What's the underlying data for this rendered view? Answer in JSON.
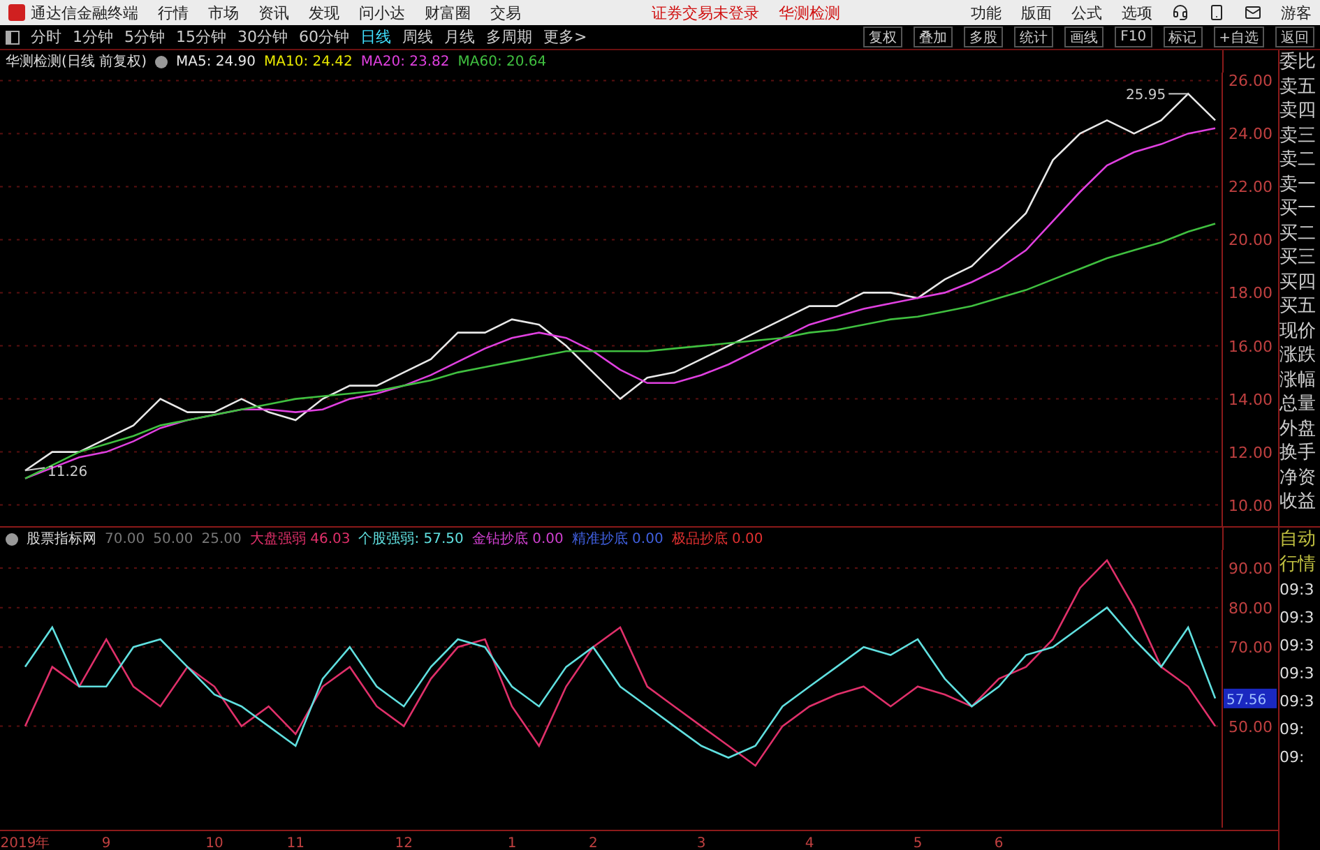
{
  "menu_bar": {
    "app_title": "通达信金融终端",
    "menus": [
      "行情",
      "市场",
      "资讯",
      "发现",
      "问小达",
      "财富圈",
      "交易"
    ],
    "notices": [
      "证券交易未登录",
      "华测检测"
    ],
    "tools": [
      "功能",
      "版面",
      "公式",
      "选项"
    ],
    "user": "游客"
  },
  "toolbar": {
    "periods": [
      {
        "label": "分时",
        "selected": false
      },
      {
        "label": "1分钟",
        "selected": false
      },
      {
        "label": "5分钟",
        "selected": false
      },
      {
        "label": "15分钟",
        "selected": false
      },
      {
        "label": "30分钟",
        "selected": false
      },
      {
        "label": "60分钟",
        "selected": false
      },
      {
        "label": "日线",
        "selected": true
      },
      {
        "label": "周线",
        "selected": false
      },
      {
        "label": "月线",
        "selected": false
      },
      {
        "label": "多周期",
        "selected": false
      },
      {
        "label": "更多>",
        "selected": false
      }
    ],
    "actions": [
      "复权",
      "叠加",
      "多股",
      "统计",
      "画线",
      "F10",
      "标记",
      "+自选",
      "返回"
    ]
  },
  "main_chart": {
    "title": "华测检测(日线 前复权)",
    "legend": [
      {
        "label": "MA5: 24.90",
        "color": "#e8e8e8"
      },
      {
        "label": "MA10: 24.42",
        "color": "#e8e800"
      },
      {
        "label": "MA20: 23.82",
        "color": "#e040e0"
      },
      {
        "label": "MA60: 20.64",
        "color": "#40c040"
      }
    ],
    "high_mark": "25.95",
    "low_mark": "11.26",
    "chart_data": {
      "type": "line",
      "grid": true,
      "categories": [
        null,
        null,
        null,
        null,
        null,
        null,
        null,
        null,
        null,
        null,
        null,
        null,
        null,
        null,
        null,
        null,
        null,
        null,
        null,
        null,
        null,
        null,
        null,
        null,
        null,
        null,
        null,
        null,
        null,
        null,
        null,
        null,
        null,
        null,
        null,
        null,
        null,
        null,
        null,
        null,
        null,
        null,
        null,
        null,
        null
      ],
      "ylim": [
        9.2,
        26.3
      ],
      "yticks": [
        {
          "value": 10,
          "label": "10.00"
        },
        {
          "value": 12,
          "label": "12.00"
        },
        {
          "value": 14,
          "label": "14.00"
        },
        {
          "value": 16,
          "label": "16.00"
        },
        {
          "value": 18,
          "label": "18.00"
        },
        {
          "value": 20,
          "label": "20.00"
        },
        {
          "value": 22,
          "label": "22.00"
        },
        {
          "value": 24,
          "label": "24.00"
        },
        {
          "value": 26,
          "label": "26.00"
        }
      ],
      "series": [
        {
          "color": "#e8e8e8",
          "values": [
            11.3,
            12,
            12,
            12.5,
            13,
            14,
            13.5,
            13.5,
            14,
            13.5,
            13.2,
            14,
            14.5,
            14.5,
            15,
            15.5,
            16.5,
            16.5,
            17,
            16.8,
            16,
            15,
            14,
            14.8,
            15,
            15.5,
            16,
            16.5,
            17,
            17.5,
            17.5,
            18,
            18,
            17.8,
            18.5,
            19,
            20,
            21,
            23,
            24,
            24.5,
            24,
            24.5,
            25.5,
            24.5
          ]
        },
        {
          "color": "#e040e0",
          "values": [
            11,
            11.4,
            11.8,
            12,
            12.4,
            12.9,
            13.2,
            13.4,
            13.6,
            13.6,
            13.5,
            13.6,
            14,
            14.2,
            14.5,
            14.9,
            15.4,
            15.9,
            16.3,
            16.5,
            16.3,
            15.8,
            15.1,
            14.6,
            14.6,
            14.9,
            15.3,
            15.8,
            16.3,
            16.8,
            17.1,
            17.4,
            17.6,
            17.8,
            18,
            18.4,
            18.9,
            19.6,
            20.7,
            21.8,
            22.8,
            23.3,
            23.6,
            24,
            24.2
          ]
        },
        {
          "color": "#40c040",
          "values": [
            11,
            11.5,
            12,
            12.3,
            12.6,
            13,
            13.2,
            13.4,
            13.6,
            13.8,
            14,
            14.1,
            14.2,
            14.3,
            14.5,
            14.7,
            15,
            15.2,
            15.4,
            15.6,
            15.8,
            15.8,
            15.8,
            15.8,
            15.9,
            16,
            16.1,
            16.2,
            16.3,
            16.5,
            16.6,
            16.8,
            17,
            17.1,
            17.3,
            17.5,
            17.8,
            18.1,
            18.5,
            18.9,
            19.3,
            19.6,
            19.9,
            20.3,
            20.6
          ]
        }
      ]
    }
  },
  "indicator": {
    "title": "股票指标网",
    "levels": [
      "70.00",
      "50.00",
      "25.00"
    ],
    "legend": [
      {
        "label": "大盘强弱",
        "value": "46.03",
        "color": "#e0306a"
      },
      {
        "label": "个股强弱:",
        "value": "57.50",
        "color": "#60e0e0"
      },
      {
        "label": "金钻抄底",
        "value": "0.00",
        "color": "#d040d0"
      },
      {
        "label": "精准抄底",
        "value": "0.00",
        "color": "#4060e0"
      },
      {
        "label": "极品抄底",
        "value": "0.00",
        "color": "#e03030"
      }
    ],
    "current_value": "57.56",
    "chart_data": {
      "type": "line",
      "categories": [
        "2019年",
        null,
        null,
        "9",
        null,
        null,
        null,
        "10",
        null,
        null,
        "11",
        null,
        null,
        null,
        "12",
        null,
        null,
        null,
        "1",
        null,
        null,
        "2",
        null,
        null,
        null,
        "3",
        null,
        null,
        null,
        "4",
        null,
        null,
        null,
        "5",
        null,
        null,
        "6",
        null,
        null,
        null,
        null,
        null,
        null,
        null,
        null
      ],
      "grid": true,
      "ylim": [
        24.3,
        94.6
      ],
      "yticks": [
        {
          "value": 50,
          "label": "50.00"
        },
        {
          "value": 70,
          "label": "70.00"
        },
        {
          "value": 80,
          "label": "80.00"
        },
        {
          "value": 90,
          "label": "90.00"
        }
      ],
      "series": [
        {
          "color": "#e0306a",
          "values": [
            50,
            65,
            60,
            72,
            60,
            55,
            65,
            60,
            50,
            55,
            48,
            60,
            65,
            55,
            50,
            62,
            70,
            72,
            55,
            45,
            60,
            70,
            75,
            60,
            55,
            50,
            45,
            40,
            50,
            55,
            58,
            60,
            55,
            60,
            58,
            55,
            62,
            65,
            72,
            85,
            92,
            80,
            65,
            60,
            50
          ]
        },
        {
          "color": "#60e0e0",
          "values": [
            65,
            75,
            60,
            60,
            70,
            72,
            65,
            58,
            55,
            50,
            45,
            62,
            70,
            60,
            55,
            65,
            72,
            70,
            60,
            55,
            65,
            70,
            60,
            55,
            50,
            45,
            42,
            45,
            55,
            60,
            65,
            70,
            68,
            72,
            62,
            55,
            60,
            68,
            70,
            75,
            80,
            72,
            65,
            75,
            57
          ]
        }
      ]
    }
  },
  "quote_panel": {
    "fields": [
      "委比",
      "卖五",
      "卖四",
      "卖三",
      "卖二",
      "卖一",
      "买一",
      "买二",
      "买三",
      "买四",
      "买五",
      "现价",
      "涨跌",
      "涨幅",
      "总量",
      "外盘",
      "换手",
      "净资",
      "收益"
    ],
    "modes": [
      "自动",
      "行情"
    ],
    "ticks": [
      "09:3",
      "09:3",
      "09:3",
      "09:3",
      "09:3",
      "09:",
      "09:"
    ]
  }
}
